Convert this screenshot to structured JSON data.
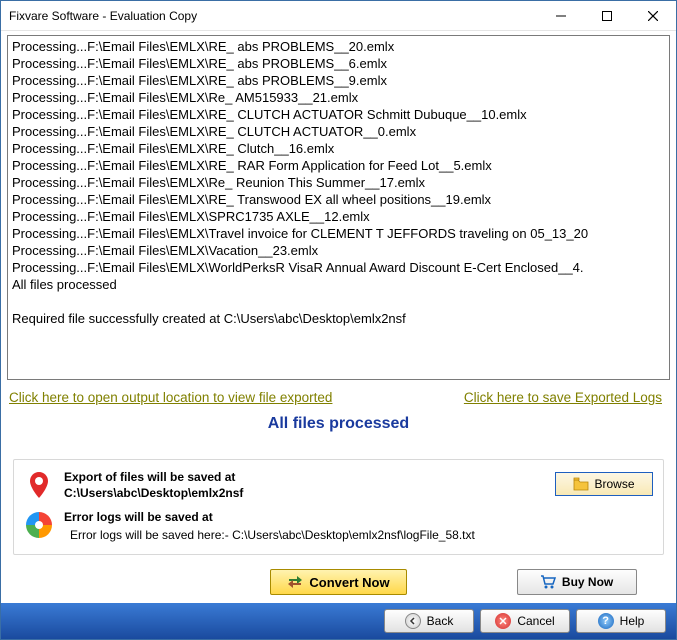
{
  "window": {
    "title": "Fixvare Software - Evaluation Copy"
  },
  "log_lines": [
    "Processing...F:\\Email Files\\EMLX\\RE_ abs PROBLEMS__20.emlx",
    "Processing...F:\\Email Files\\EMLX\\RE_ abs PROBLEMS__6.emlx",
    "Processing...F:\\Email Files\\EMLX\\RE_ abs PROBLEMS__9.emlx",
    "Processing...F:\\Email Files\\EMLX\\Re_ AM515933__21.emlx",
    "Processing...F:\\Email Files\\EMLX\\RE_ CLUTCH ACTUATOR Schmitt Dubuque__10.emlx",
    "Processing...F:\\Email Files\\EMLX\\RE_ CLUTCH ACTUATOR__0.emlx",
    "Processing...F:\\Email Files\\EMLX\\RE_ Clutch__16.emlx",
    "Processing...F:\\Email Files\\EMLX\\RE_ RAR Form Application for Feed Lot__5.emlx",
    "Processing...F:\\Email Files\\EMLX\\Re_ Reunion This Summer__17.emlx",
    "Processing...F:\\Email Files\\EMLX\\RE_ Transwood EX all wheel positions__19.emlx",
    "Processing...F:\\Email Files\\EMLX\\SPRC1735 AXLE__12.emlx",
    "Processing...F:\\Email Files\\EMLX\\Travel invoice for CLEMENT T JEFFORDS traveling on 05_13_20",
    "Processing...F:\\Email Files\\EMLX\\Vacation__23.emlx",
    "Processing...F:\\Email Files\\EMLX\\WorldPerksR VisaR Annual Award Discount E-Cert Enclosed__4.",
    "All files processed",
    "",
    "Required file successfully created at C:\\Users\\abc\\Desktop\\emlx2nsf"
  ],
  "links": {
    "open_output": "Click here to open output location to view file exported",
    "save_logs": "Click here to save Exported Logs"
  },
  "status": "All files processed",
  "export_row": {
    "label": "Export of files will be saved at",
    "path": "C:\\Users\\abc\\Desktop\\emlx2nsf",
    "browse": "Browse"
  },
  "errorlog_row": {
    "label": "Error logs will be saved at",
    "path": "Error logs will be saved here:- C:\\Users\\abc\\Desktop\\emlx2nsf\\logFile_58.txt"
  },
  "buttons": {
    "convert": "Convert Now",
    "buy": "Buy Now",
    "back": "Back",
    "cancel": "Cancel",
    "help": "Help"
  }
}
